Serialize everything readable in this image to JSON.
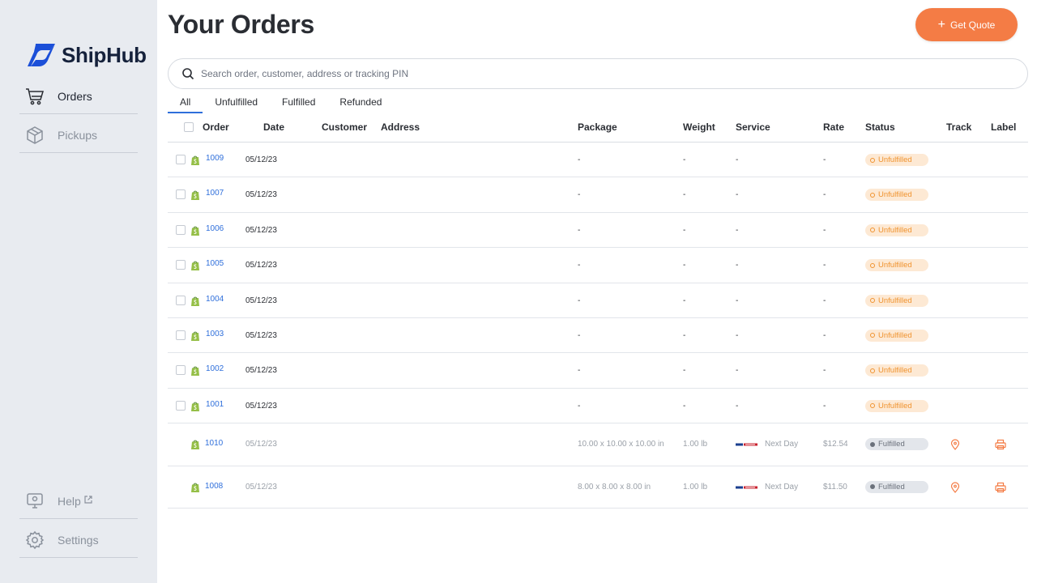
{
  "app": {
    "name": "ShipHub",
    "brand_color": "#1b4fd8",
    "accent_color": "#f47c45"
  },
  "sidebar": {
    "items": [
      {
        "label": "Orders",
        "icon": "cart-icon",
        "active": true
      },
      {
        "label": "Pickups",
        "icon": "box-icon",
        "active": false
      },
      {
        "label": "Help",
        "icon": "help-icon",
        "active": false,
        "external": true
      },
      {
        "label": "Settings",
        "icon": "gear-icon",
        "active": false
      }
    ]
  },
  "header": {
    "title": "Your Orders",
    "quote_button": "Get Quote"
  },
  "search": {
    "placeholder": "Search order, customer, address or tracking PIN",
    "value": ""
  },
  "tabs": [
    {
      "label": "All",
      "active": true
    },
    {
      "label": "Unfulfilled",
      "active": false
    },
    {
      "label": "Fulfilled",
      "active": false
    },
    {
      "label": "Refunded",
      "active": false
    }
  ],
  "table": {
    "columns": [
      "Order",
      "Date",
      "Customer",
      "Address",
      "Package",
      "Weight",
      "Service",
      "Rate",
      "Status",
      "Track",
      "Label"
    ],
    "rows": [
      {
        "order": "1009",
        "date": "05/12/23",
        "customer": "",
        "address": "",
        "package": "-",
        "weight": "-",
        "service": "-",
        "rate": "-",
        "status": "Unfulfilled"
      },
      {
        "order": "1007",
        "date": "05/12/23",
        "customer": "",
        "address": "",
        "package": "-",
        "weight": "-",
        "service": "-",
        "rate": "-",
        "status": "Unfulfilled"
      },
      {
        "order": "1006",
        "date": "05/12/23",
        "customer": "",
        "address": "",
        "package": "-",
        "weight": "-",
        "service": "-",
        "rate": "-",
        "status": "Unfulfilled"
      },
      {
        "order": "1005",
        "date": "05/12/23",
        "customer": "",
        "address": "",
        "package": "-",
        "weight": "-",
        "service": "-",
        "rate": "-",
        "status": "Unfulfilled"
      },
      {
        "order": "1004",
        "date": "05/12/23",
        "customer": "",
        "address": "",
        "package": "-",
        "weight": "-",
        "service": "-",
        "rate": "-",
        "status": "Unfulfilled"
      },
      {
        "order": "1003",
        "date": "05/12/23",
        "customer": "",
        "address": "",
        "package": "-",
        "weight": "-",
        "service": "-",
        "rate": "-",
        "status": "Unfulfilled"
      },
      {
        "order": "1002",
        "date": "05/12/23",
        "customer": "",
        "address": "",
        "package": "-",
        "weight": "-",
        "service": "-",
        "rate": "-",
        "status": "Unfulfilled"
      },
      {
        "order": "1001",
        "date": "05/12/23",
        "customer": "",
        "address": "",
        "package": "-",
        "weight": "-",
        "service": "-",
        "rate": "-",
        "status": "Unfulfilled"
      }
    ],
    "fulfilled_rows": [
      {
        "order": "1010",
        "date": "05/12/23",
        "package": "10.00 x 10.00 x 10.00 in",
        "weight": "1.00 lb",
        "service": "Next Day",
        "rate": "$12.54",
        "status": "Fulfilled"
      },
      {
        "order": "1008",
        "date": "05/12/23",
        "package": "8.00 x 8.00 x 8.00 in",
        "weight": "1.00 lb",
        "service": "Next Day",
        "rate": "$11.50",
        "status": "Fulfilled"
      }
    ]
  }
}
